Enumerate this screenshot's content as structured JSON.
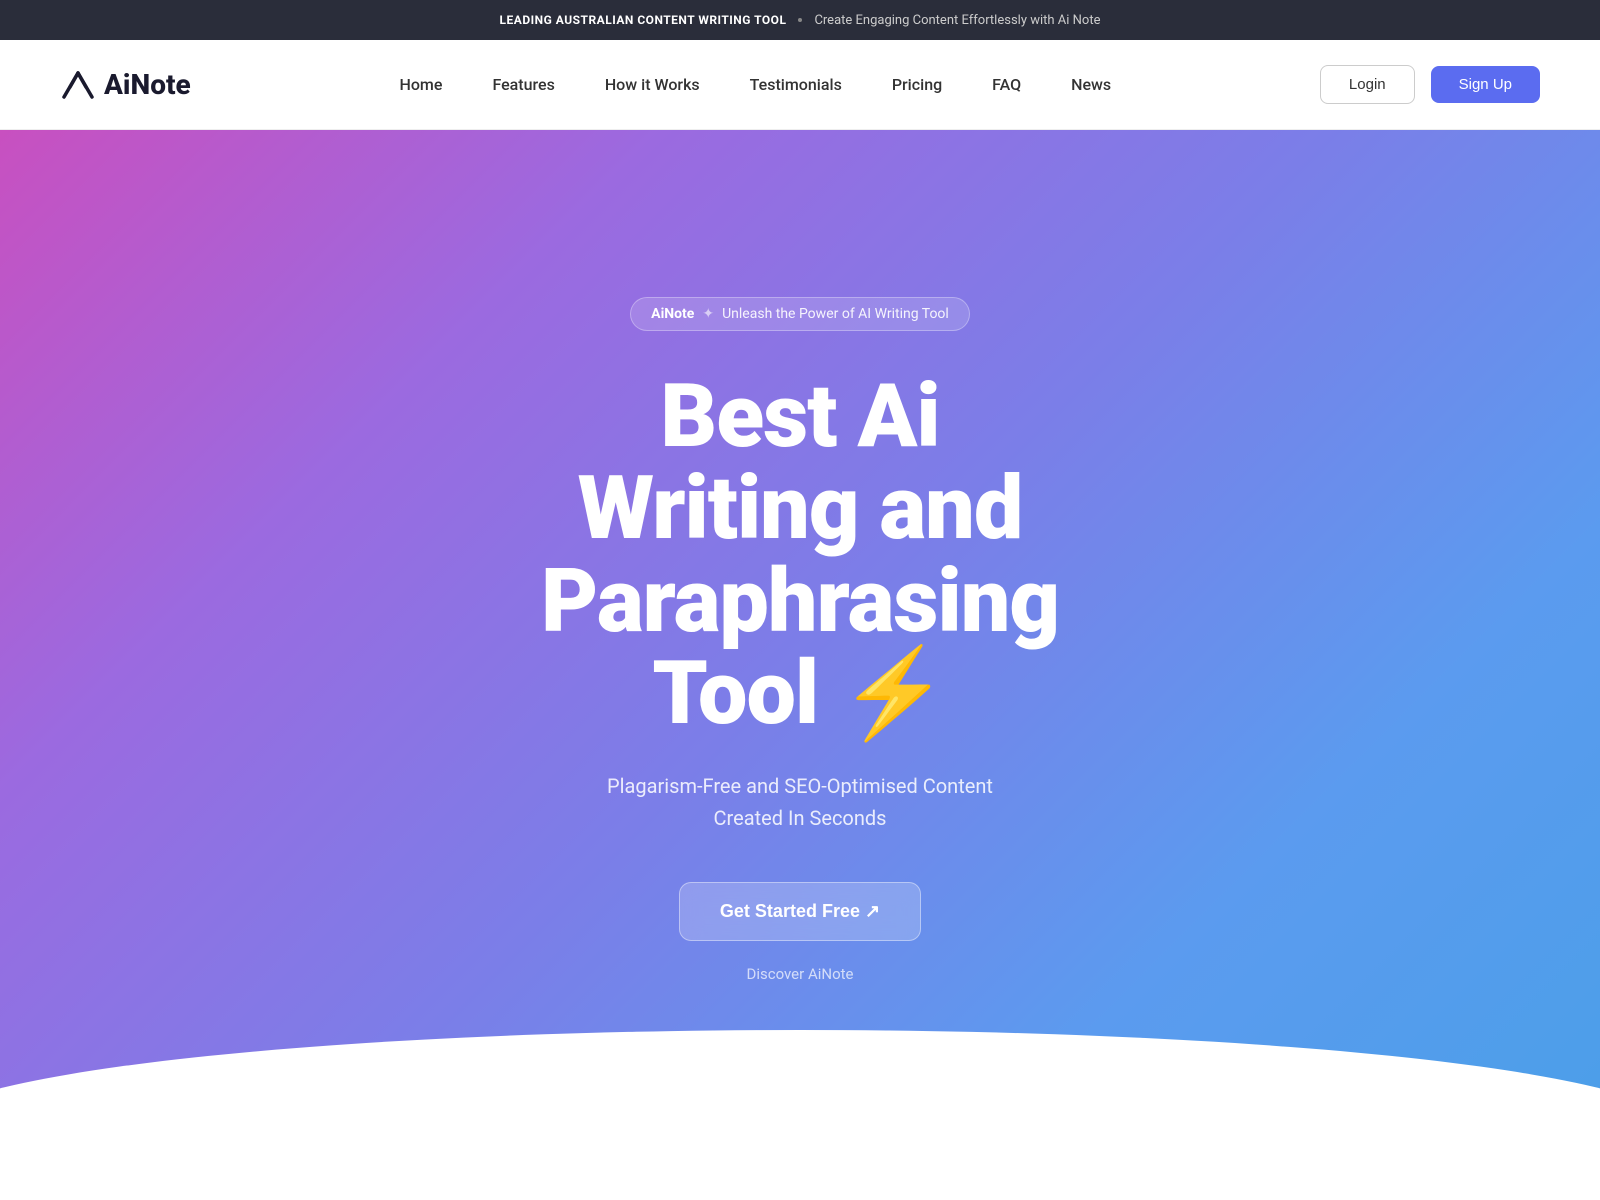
{
  "announcement": {
    "brand": "Leading Australian Content Writing Tool",
    "tagline": "Create Engaging Content Effortlessly with Ai Note"
  },
  "navbar": {
    "logo_text": "AiNote",
    "nav_items": [
      {
        "label": "Home",
        "href": "#"
      },
      {
        "label": "Features",
        "href": "#"
      },
      {
        "label": "How it Works",
        "href": "#"
      },
      {
        "label": "Testimonials",
        "href": "#"
      },
      {
        "label": "Pricing",
        "href": "#"
      },
      {
        "label": "FAQ",
        "href": "#"
      },
      {
        "label": "News",
        "href": "#"
      }
    ],
    "login_label": "Login",
    "signup_label": "Sign Up"
  },
  "hero": {
    "badge_brand": "AiNote",
    "badge_separator": "✦",
    "badge_text": "Unleash the Power of AI Writing Tool",
    "title_line1": "Best Ai",
    "title_line2": "Writing and",
    "title_line3": "Paraphrasing",
    "title_line4": "Tool ⚡",
    "subtitle_line1": "Plagarism-Free and SEO-Optimised Content",
    "subtitle_line2": "Created In Seconds",
    "cta_label": "Get Started Free ↗",
    "discover_label": "Discover AiNote"
  }
}
